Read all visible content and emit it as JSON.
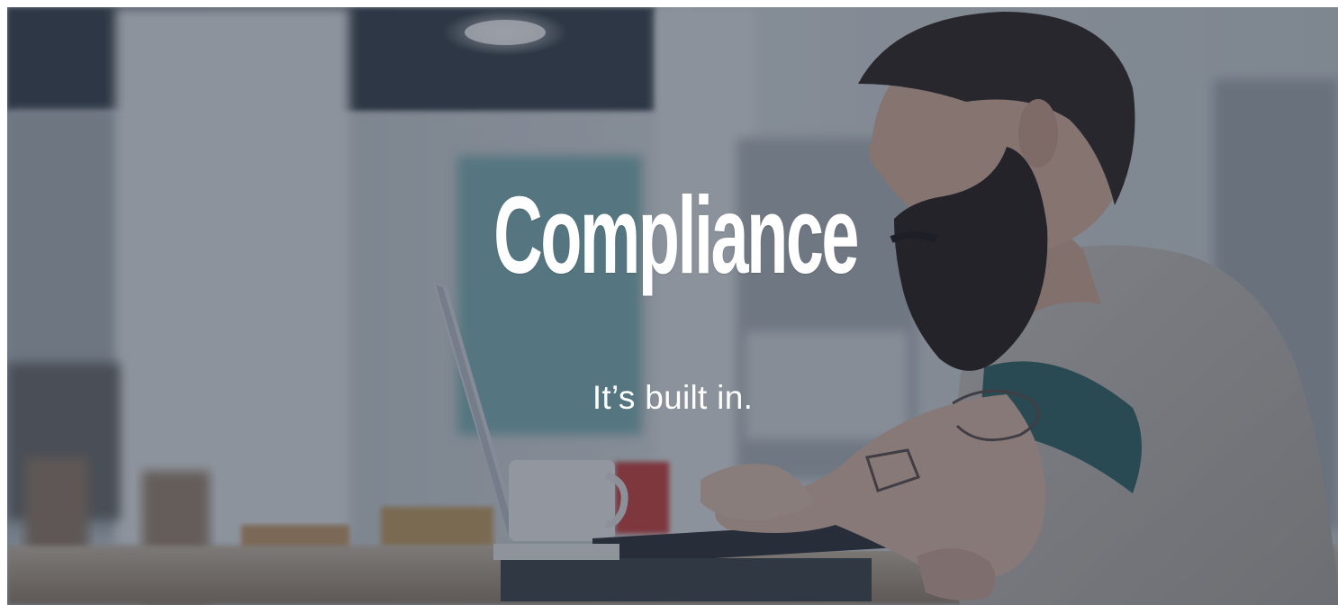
{
  "hero": {
    "headline": "Compliance",
    "tagline": "It’s built in.",
    "background_image": "photo of a bearded man with tattoos working on a laptop at a cafe counter",
    "overlay_color": "#232d3e"
  }
}
